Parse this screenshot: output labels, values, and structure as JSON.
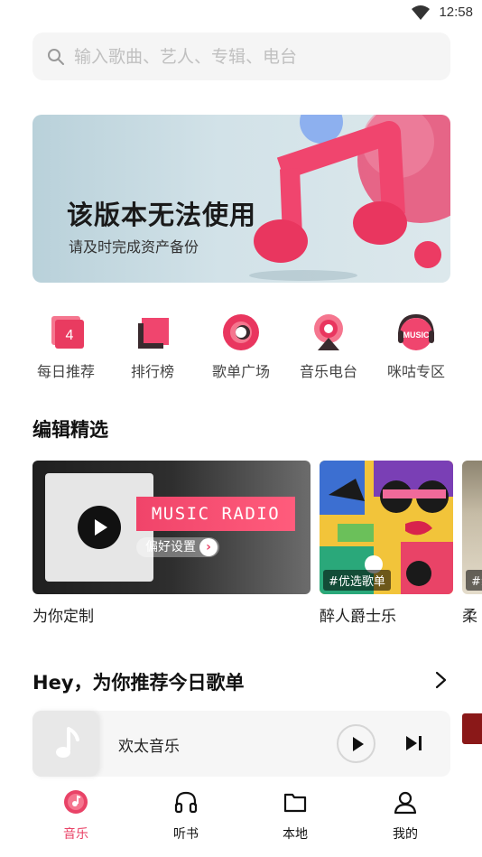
{
  "status_bar": {
    "time": "12:58"
  },
  "search": {
    "placeholder": "输入歌曲、艺人、专辑、电台"
  },
  "banner": {
    "title": "该版本无法使用",
    "subtitle": "请及时完成资产备份"
  },
  "quick_nav": [
    {
      "label": "每日推荐",
      "icon": "calendar-icon",
      "badge": "4"
    },
    {
      "label": "排行榜",
      "icon": "chart-icon"
    },
    {
      "label": "歌单广场",
      "icon": "vinyl-icon"
    },
    {
      "label": "音乐电台",
      "icon": "radio-icon"
    },
    {
      "label": "咪咕专区",
      "icon": "migu-icon",
      "badge": "MUSIC"
    }
  ],
  "editor_picks": {
    "title": "编辑精选",
    "cards": [
      {
        "label": "为你定制",
        "banner_text": "MUSIC RADIO",
        "pref_label": "偏好设置"
      },
      {
        "label": "醉人爵士乐",
        "tag": "#优选歌单"
      },
      {
        "label": "柔",
        "tag": "#纟"
      }
    ]
  },
  "recommend": {
    "title": "Hey，为你推荐今日歌单"
  },
  "mini_player": {
    "song": "欢太音乐"
  },
  "tabbar": [
    {
      "label": "音乐",
      "icon": "music-disc-icon",
      "active": true
    },
    {
      "label": "听书",
      "icon": "headphones-icon"
    },
    {
      "label": "本地",
      "icon": "folder-icon"
    },
    {
      "label": "我的",
      "icon": "user-icon"
    }
  ],
  "colors": {
    "accent": "#e94367",
    "text": "#111111",
    "muted": "#444444"
  }
}
